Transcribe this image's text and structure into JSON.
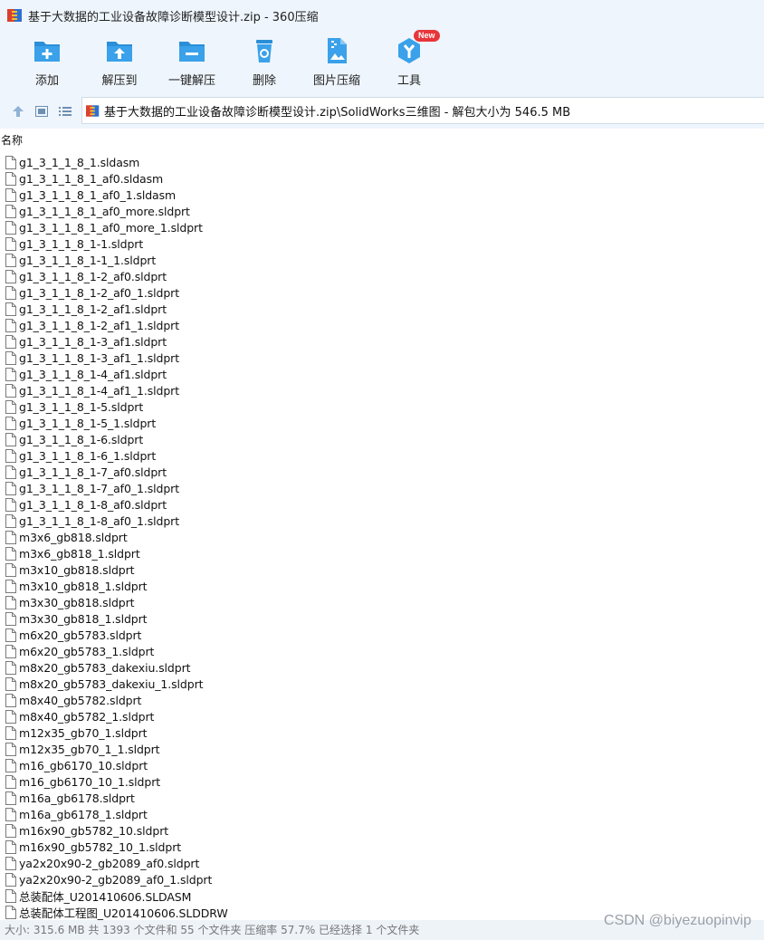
{
  "window": {
    "title": "基于大数据的工业设备故障诊断模型设计.zip - 360压缩"
  },
  "toolbar": {
    "items": [
      {
        "label": "添加",
        "icon": "add-icon"
      },
      {
        "label": "解压到",
        "icon": "extract-to-icon"
      },
      {
        "label": "一键解压",
        "icon": "one-click-extract-icon"
      },
      {
        "label": "删除",
        "icon": "delete-icon"
      },
      {
        "label": "图片压缩",
        "icon": "image-compress-icon"
      },
      {
        "label": "工具",
        "icon": "tools-icon",
        "badge": "New"
      }
    ]
  },
  "address": {
    "path": "基于大数据的工业设备故障诊断模型设计.zip\\SolidWorks三维图 - 解包大小为 546.5 MB"
  },
  "list": {
    "column_name": "名称",
    "files": [
      "g1_3_1_1_8_1.sldasm",
      "g1_3_1_1_8_1_af0.sldasm",
      "g1_3_1_1_8_1_af0_1.sldasm",
      "g1_3_1_1_8_1_af0_more.sldprt",
      "g1_3_1_1_8_1_af0_more_1.sldprt",
      "g1_3_1_1_8_1-1.sldprt",
      "g1_3_1_1_8_1-1_1.sldprt",
      "g1_3_1_1_8_1-2_af0.sldprt",
      "g1_3_1_1_8_1-2_af0_1.sldprt",
      "g1_3_1_1_8_1-2_af1.sldprt",
      "g1_3_1_1_8_1-2_af1_1.sldprt",
      "g1_3_1_1_8_1-3_af1.sldprt",
      "g1_3_1_1_8_1-3_af1_1.sldprt",
      "g1_3_1_1_8_1-4_af1.sldprt",
      "g1_3_1_1_8_1-4_af1_1.sldprt",
      "g1_3_1_1_8_1-5.sldprt",
      "g1_3_1_1_8_1-5_1.sldprt",
      "g1_3_1_1_8_1-6.sldprt",
      "g1_3_1_1_8_1-6_1.sldprt",
      "g1_3_1_1_8_1-7_af0.sldprt",
      "g1_3_1_1_8_1-7_af0_1.sldprt",
      "g1_3_1_1_8_1-8_af0.sldprt",
      "g1_3_1_1_8_1-8_af0_1.sldprt",
      "m3x6_gb818.sldprt",
      "m3x6_gb818_1.sldprt",
      "m3x10_gb818.sldprt",
      "m3x10_gb818_1.sldprt",
      "m3x30_gb818.sldprt",
      "m3x30_gb818_1.sldprt",
      "m6x20_gb5783.sldprt",
      "m6x20_gb5783_1.sldprt",
      "m8x20_gb5783_dakexiu.sldprt",
      "m8x20_gb5783_dakexiu_1.sldprt",
      "m8x40_gb5782.sldprt",
      "m8x40_gb5782_1.sldprt",
      "m12x35_gb70_1.sldprt",
      "m12x35_gb70_1_1.sldprt",
      "m16_gb6170_10.sldprt",
      "m16_gb6170_10_1.sldprt",
      "m16a_gb6178.sldprt",
      "m16a_gb6178_1.sldprt",
      "m16x90_gb5782_10.sldprt",
      "m16x90_gb5782_10_1.sldprt",
      "ya2x20x90-2_gb2089_af0.sldprt",
      "ya2x20x90-2_gb2089_af0_1.sldprt",
      "总装配体_U201410606.SLDASM",
      "总装配体工程图_U201410606.SLDDRW"
    ]
  },
  "status": {
    "text": "大小: 315.6 MB 共 1393 个文件和 55 个文件夹 压缩率 57.7% 已经选择 1 个文件夹"
  },
  "watermark": {
    "text": "CSDN @biyezuopinvip"
  },
  "colors": {
    "toolbar_bg": "#eef5fc",
    "icon_blue": "#2a8fd8",
    "badge_red": "#e8353a"
  }
}
